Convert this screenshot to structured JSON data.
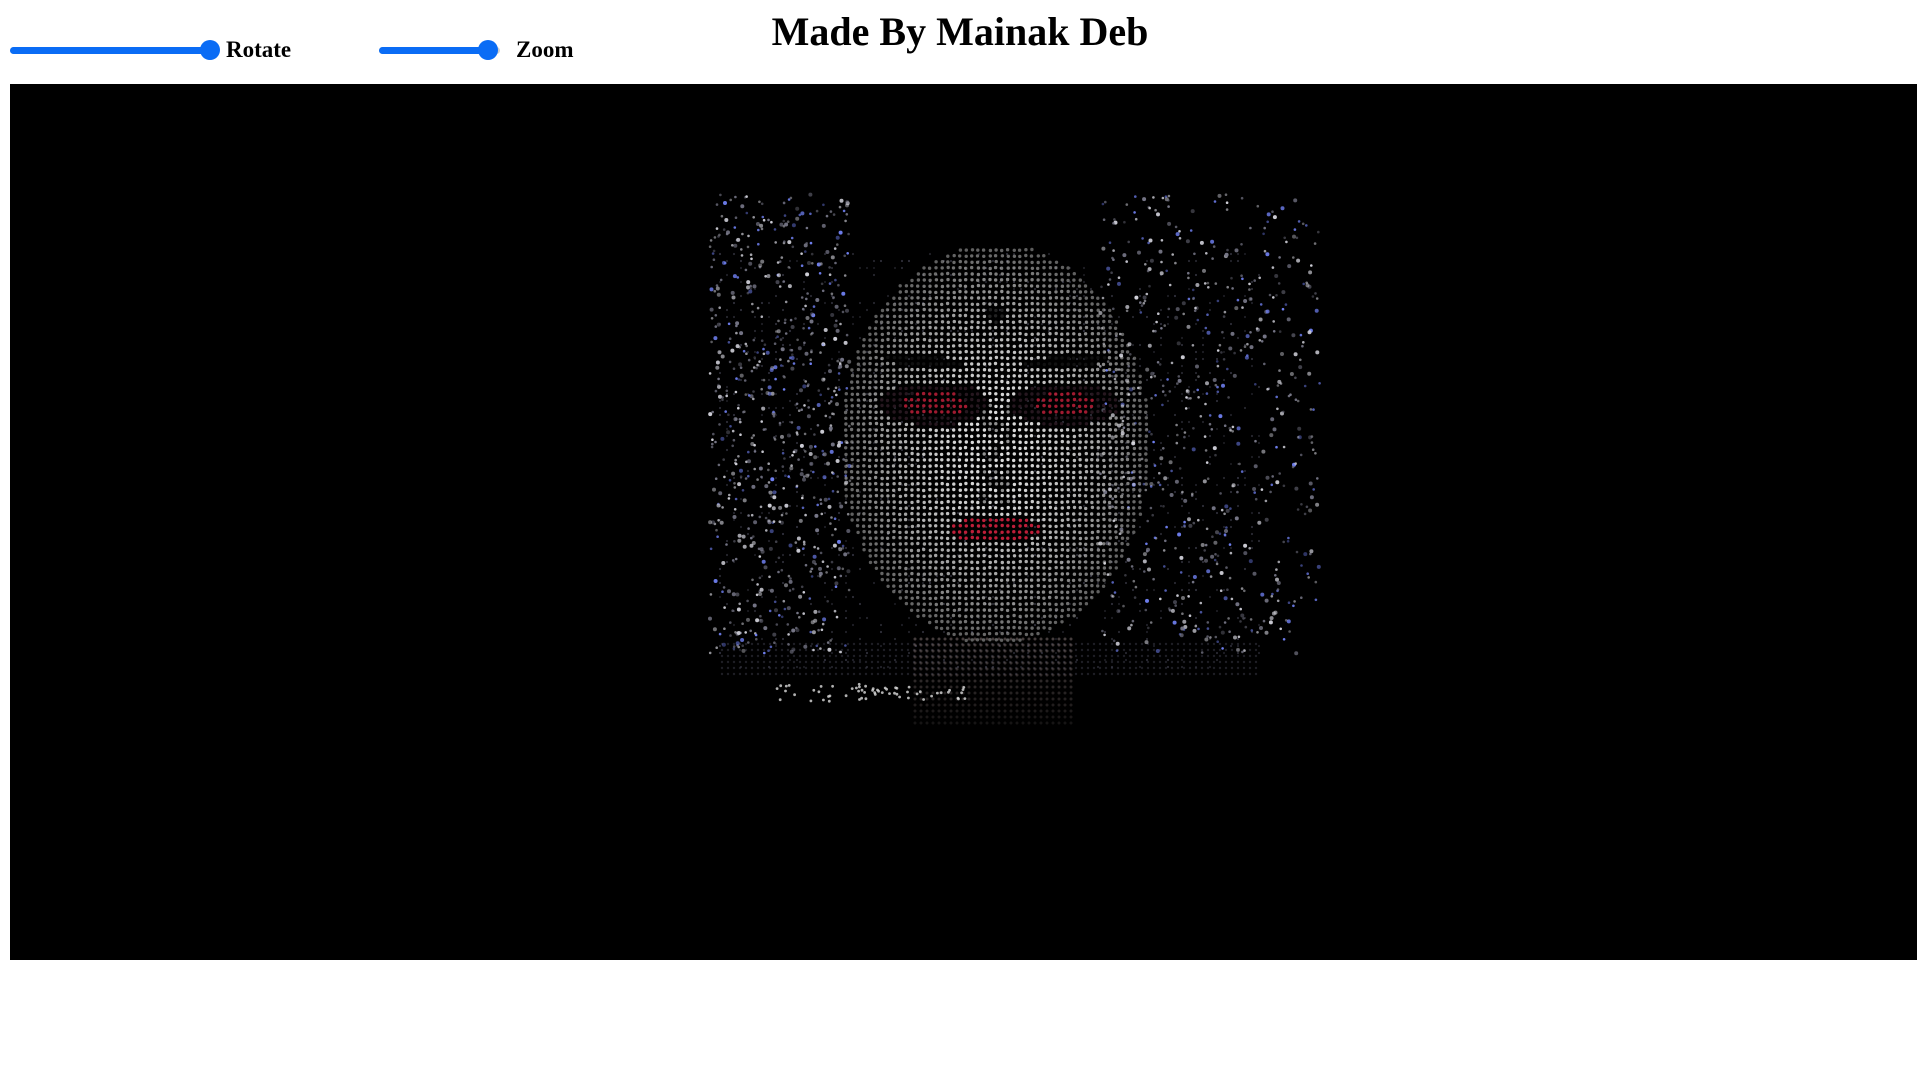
{
  "title": "Made By Mainak Deb",
  "controls": {
    "rotate": {
      "label": "Rotate",
      "value": 1.0
    },
    "zoom": {
      "label": "Zoom",
      "value": 0.9
    }
  },
  "viewer": {
    "background": "#000000",
    "content": "point-cloud portrait of a face"
  },
  "colors": {
    "accent": "#0a6cf5",
    "point_light": "#e8e8e8",
    "point_mid": "#9a9a9a",
    "point_red": "#c8203c",
    "point_blue": "#6f7ff0"
  }
}
